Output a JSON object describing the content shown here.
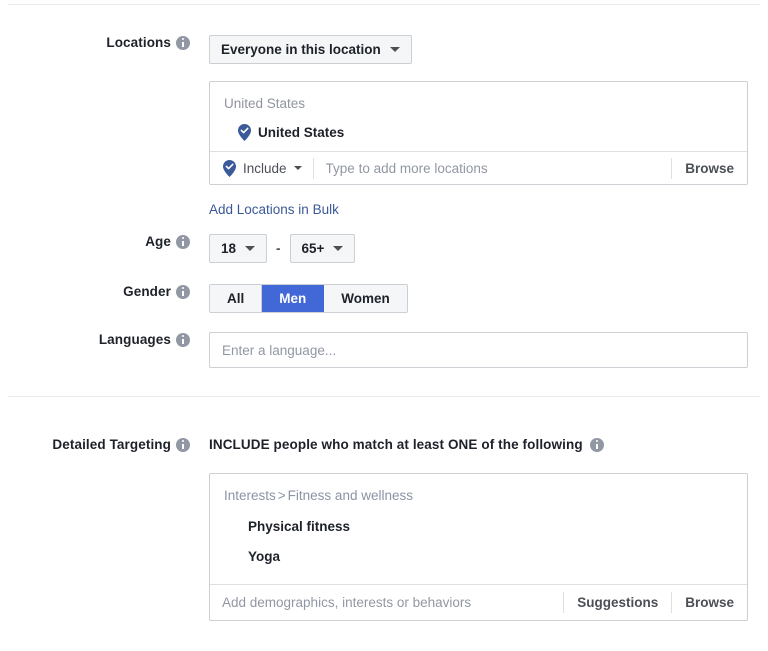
{
  "sections": {
    "locations": {
      "label": "Locations",
      "info_icon": "info-icon",
      "scope_button": {
        "label": "Everyone in this location",
        "caret_icon": "chevron-down-icon"
      },
      "panel": {
        "heading": "United States",
        "selected": [
          {
            "name": "United States",
            "pin_icon": "map-pin-check-icon"
          }
        ],
        "input_row": {
          "mode_label": "Include",
          "mode_pin_icon": "map-pin-check-icon",
          "mode_caret_icon": "chevron-down-icon",
          "placeholder": "Type to add more locations",
          "value": "",
          "browse_label": "Browse"
        }
      },
      "bulk_link": "Add Locations in Bulk"
    },
    "age": {
      "label": "Age",
      "info_icon": "info-icon",
      "min": "18",
      "max": "65+",
      "separator": "-"
    },
    "gender": {
      "label": "Gender",
      "info_icon": "info-icon",
      "options": [
        "All",
        "Men",
        "Women"
      ],
      "selected": "Men",
      "selected_color": "#4267d6"
    },
    "languages": {
      "label": "Languages",
      "info_icon": "info-icon",
      "placeholder": "Enter a language...",
      "value": ""
    },
    "detailed_targeting": {
      "label": "Detailed Targeting",
      "info_icon": "info-icon",
      "include_heading": "INCLUDE people who match at least ONE of the following",
      "heading_info_icon": "info-icon",
      "panel": {
        "breadcrumb": {
          "root": "Interests",
          "separator": ">",
          "category": "Fitness and wellness"
        },
        "items": [
          "Physical fitness",
          "Yoga"
        ],
        "input_row": {
          "placeholder": "Add demographics, interests or behaviors",
          "value": "",
          "suggestions_label": "Suggestions",
          "browse_label": "Browse"
        }
      }
    }
  },
  "colors": {
    "link": "#3b5998",
    "accent": "#4267d6",
    "pin": "#3b5a9a",
    "border": "#ccd0d5",
    "muted": "#90949c"
  }
}
